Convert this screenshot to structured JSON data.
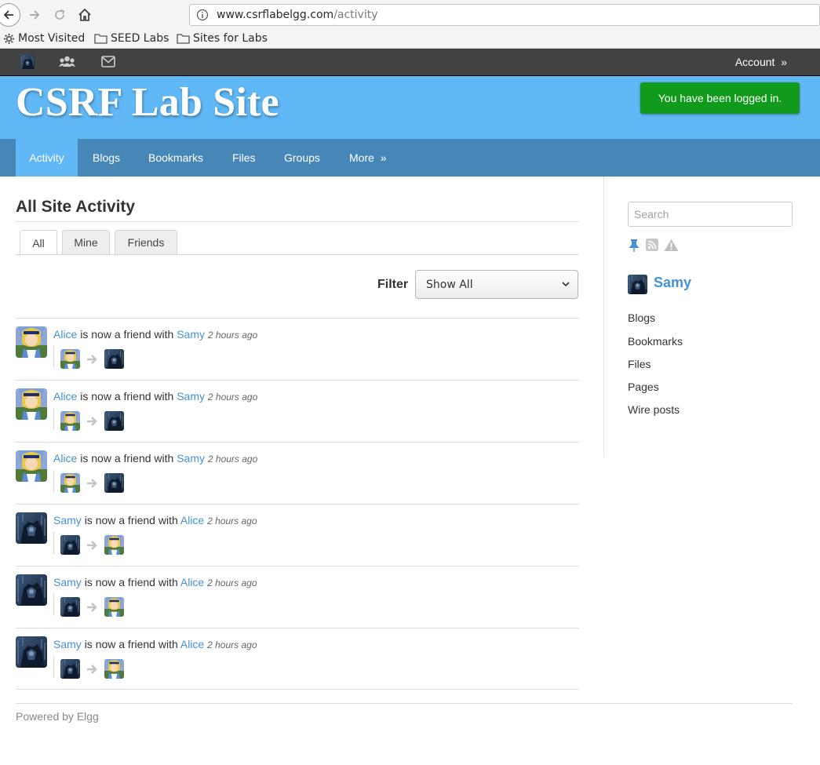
{
  "browser": {
    "url_host": "www.csrflabelgg.com",
    "url_path": "/activity",
    "bookmarks": [
      "Most Visited",
      "SEED Labs",
      "Sites for Labs"
    ]
  },
  "topbar": {
    "account_label": "Account",
    "account_suffix": "»"
  },
  "header": {
    "site_title": "CSRF Lab Site",
    "system_message": "You have been logged in."
  },
  "site_nav": {
    "items": [
      "Activity",
      "Blogs",
      "Bookmarks",
      "Files",
      "Groups",
      "More"
    ],
    "more_suffix": "»",
    "active": "Activity"
  },
  "main": {
    "title": "All Site Activity",
    "tabs": [
      "All",
      "Mine",
      "Friends"
    ],
    "selected_tab": "All",
    "filter_label": "Filter",
    "filter_value": "Show All"
  },
  "river": [
    {
      "subject": "Alice",
      "verb": "is now a friend with",
      "object": "Samy",
      "time": "2 hours ago"
    },
    {
      "subject": "Alice",
      "verb": "is now a friend with",
      "object": "Samy",
      "time": "2 hours ago"
    },
    {
      "subject": "Alice",
      "verb": "is now a friend with",
      "object": "Samy",
      "time": "2 hours ago"
    },
    {
      "subject": "Samy",
      "verb": "is now a friend with",
      "object": "Alice",
      "time": "2 hours ago"
    },
    {
      "subject": "Samy",
      "verb": "is now a friend with",
      "object": "Alice",
      "time": "2 hours ago"
    },
    {
      "subject": "Samy",
      "verb": "is now a friend with",
      "object": "Alice",
      "time": "2 hours ago"
    }
  ],
  "sidebar": {
    "search_placeholder": "Search",
    "owner_name": "Samy",
    "links": [
      "Blogs",
      "Bookmarks",
      "Files",
      "Pages",
      "Wire posts"
    ]
  },
  "footer": {
    "text": "Powered by Elgg"
  },
  "colors": {
    "topbar": "#424242",
    "header": "#60b8f7",
    "nav": "#4787b8",
    "link": "#4690d6",
    "success": "#119b1c"
  }
}
